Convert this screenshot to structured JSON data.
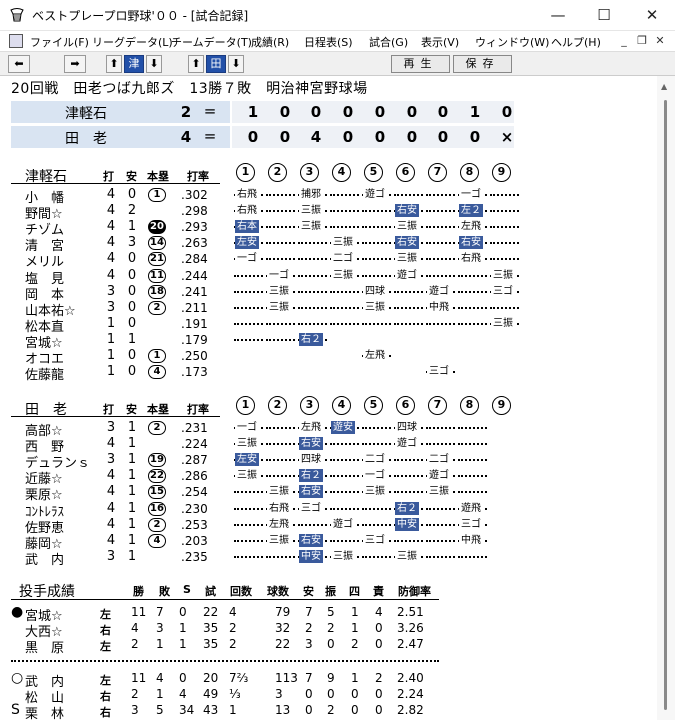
{
  "window": {
    "title": "ベストプレープロ野球'００ - [試合記録]",
    "minimize": "—",
    "maximize": "☐",
    "close": "✕"
  },
  "menu": [
    "ファイル(F)",
    "リーグデータ(L)",
    "チームデータ(T)",
    "成績(R)",
    "日程表(S)",
    "試合(G)",
    "表示(V)",
    "ウィンドウ(W)",
    "ヘルプ(H)"
  ],
  "toolbar": {
    "team_a": "津",
    "team_b": "田",
    "replay": "再生",
    "save": "保存"
  },
  "game": {
    "header": "20回戦　田老つば九郎ズ　13勝７敗　明治神宮野球場"
  },
  "scoreboard": [
    {
      "team": "津軽石",
      "total": "2",
      "eq": "=",
      "innings": [
        "1",
        "0",
        "0",
        "0",
        "0",
        "0",
        "0",
        "1",
        "0"
      ]
    },
    {
      "team": "田　老",
      "total": "4",
      "eq": "=",
      "innings": [
        "0",
        "0",
        "4",
        "0",
        "0",
        "0",
        "0",
        "0",
        "×"
      ]
    }
  ],
  "bat_headers": {
    "at_bats": "打",
    "hits": "安",
    "hr": "本塁",
    "avg": "打率",
    "innings": [
      "1",
      "2",
      "3",
      "4",
      "5",
      "6",
      "7",
      "8",
      "9"
    ]
  },
  "away_batting": {
    "team": "津軽石",
    "players": [
      {
        "name": "小　幡",
        "ab": "4",
        "h": "0",
        "hr": "1",
        "hr_fill": false,
        "avg": ".302",
        "results": [
          [
            "右飛",
            "n"
          ],
          [
            "",
            "dot"
          ],
          [
            "捕邪",
            "n"
          ],
          [
            "",
            "dot"
          ],
          [
            "遊ゴ",
            "n"
          ],
          [
            "",
            "dot"
          ],
          [
            "",
            "dot"
          ],
          [
            "一ゴ",
            "n"
          ],
          [
            "",
            "dot"
          ]
        ]
      },
      {
        "name": "野間☆",
        "ab": "4",
        "h": "2",
        "hr": "",
        "hr_fill": false,
        "avg": ".298",
        "results": [
          [
            "右飛",
            "n"
          ],
          [
            "",
            "dot"
          ],
          [
            "三振",
            "n"
          ],
          [
            "",
            "dot"
          ],
          [
            "",
            "dot"
          ],
          [
            "右安",
            "h"
          ],
          [
            "",
            "dot"
          ],
          [
            "左２",
            "h"
          ],
          [
            "",
            "dot"
          ]
        ]
      },
      {
        "name": "チゾム",
        "ab": "4",
        "h": "1",
        "hr": "20",
        "hr_fill": true,
        "avg": ".293",
        "results": [
          [
            "右本",
            "h"
          ],
          [
            "",
            "dot"
          ],
          [
            "三振",
            "n"
          ],
          [
            "",
            "dot"
          ],
          [
            "",
            "dot"
          ],
          [
            "三振",
            "n"
          ],
          [
            "",
            "dot"
          ],
          [
            "左飛",
            "n"
          ],
          [
            "",
            "dot"
          ]
        ]
      },
      {
        "name": "清　宮",
        "ab": "4",
        "h": "3",
        "hr": "14",
        "hr_fill": false,
        "avg": ".263",
        "results": [
          [
            "左安",
            "h"
          ],
          [
            "",
            "dot"
          ],
          [
            "",
            "dot"
          ],
          [
            "三振",
            "n"
          ],
          [
            "",
            "dot"
          ],
          [
            "右安",
            "h"
          ],
          [
            "",
            "dot"
          ],
          [
            "右安",
            "h"
          ],
          [
            "",
            "dot"
          ]
        ]
      },
      {
        "name": "メリル",
        "ab": "4",
        "h": "0",
        "hr": "21",
        "hr_fill": false,
        "avg": ".284",
        "results": [
          [
            "一ゴ",
            "n"
          ],
          [
            "",
            "dot"
          ],
          [
            "",
            "dot"
          ],
          [
            "二ゴ",
            "n"
          ],
          [
            "",
            "dot"
          ],
          [
            "三振",
            "n"
          ],
          [
            "",
            "dot"
          ],
          [
            "右飛",
            "n"
          ],
          [
            "",
            "dot"
          ]
        ]
      },
      {
        "name": "塩　見",
        "ab": "4",
        "h": "0",
        "hr": "11",
        "hr_fill": false,
        "avg": ".244",
        "results": [
          [
            "",
            "dot"
          ],
          [
            "一ゴ",
            "n"
          ],
          [
            "",
            "dot"
          ],
          [
            "三振",
            "n"
          ],
          [
            "",
            "dot"
          ],
          [
            "遊ゴ",
            "n"
          ],
          [
            "",
            "dot"
          ],
          [
            "",
            "dot"
          ],
          [
            "三振",
            "n"
          ]
        ]
      },
      {
        "name": "岡　本",
        "ab": "3",
        "h": "0",
        "hr": "18",
        "hr_fill": false,
        "avg": ".241",
        "results": [
          [
            "",
            "dot"
          ],
          [
            "三振",
            "n"
          ],
          [
            "",
            "dot"
          ],
          [
            "",
            "dot"
          ],
          [
            "四球",
            "n"
          ],
          [
            "",
            "dot"
          ],
          [
            "遊ゴ",
            "n"
          ],
          [
            "",
            "dot"
          ],
          [
            "三ゴ",
            "n"
          ]
        ]
      },
      {
        "name": "山本祐☆",
        "ab": "3",
        "h": "0",
        "hr": "2",
        "hr_fill": false,
        "avg": ".211",
        "results": [
          [
            "",
            "dot"
          ],
          [
            "三振",
            "n"
          ],
          [
            "",
            "dot"
          ],
          [
            "",
            "dot"
          ],
          [
            "三振",
            "n"
          ],
          [
            "",
            "dot"
          ],
          [
            "中飛",
            "n"
          ],
          [
            "",
            "dot"
          ],
          [
            "",
            "dot"
          ]
        ]
      },
      {
        "name": "松本直",
        "ab": "1",
        "h": "0",
        "hr": "",
        "hr_fill": false,
        "avg": ".191",
        "results": [
          [
            "",
            "dot"
          ],
          [
            "",
            "dot"
          ],
          [
            "",
            "dot"
          ],
          [
            "",
            "dot"
          ],
          [
            "",
            "dot"
          ],
          [
            "",
            "dot"
          ],
          [
            "",
            "dot"
          ],
          [
            "",
            "dot"
          ],
          [
            "三振",
            "n"
          ]
        ]
      },
      {
        "name": "宮城☆",
        "ab": "1",
        "h": "1",
        "hr": "",
        "hr_fill": false,
        "avg": ".179",
        "results": [
          [
            "",
            "dot"
          ],
          [
            "",
            "dot"
          ],
          [
            "右２",
            "h"
          ],
          [
            "",
            "none"
          ],
          [
            "",
            "none"
          ],
          [
            "",
            "none"
          ],
          [
            "",
            "none"
          ],
          [
            "",
            "none"
          ],
          [
            "",
            "none"
          ]
        ]
      },
      {
        "name": "オコエ",
        "ab": "1",
        "h": "0",
        "hr": "1",
        "hr_fill": false,
        "avg": ".250",
        "results": [
          [
            "",
            "none"
          ],
          [
            "",
            "none"
          ],
          [
            "",
            "none"
          ],
          [
            "",
            "none"
          ],
          [
            "左飛",
            "n"
          ],
          [
            "",
            "none"
          ],
          [
            "",
            "none"
          ],
          [
            "",
            "none"
          ],
          [
            "",
            "none"
          ]
        ]
      },
      {
        "name": "佐藤龍",
        "ab": "1",
        "h": "0",
        "hr": "4",
        "hr_fill": false,
        "avg": ".173",
        "results": [
          [
            "",
            "none"
          ],
          [
            "",
            "none"
          ],
          [
            "",
            "none"
          ],
          [
            "",
            "none"
          ],
          [
            "",
            "none"
          ],
          [
            "",
            "none"
          ],
          [
            "三ゴ",
            "n"
          ],
          [
            "",
            "none"
          ],
          [
            "",
            "none"
          ]
        ]
      }
    ]
  },
  "home_batting": {
    "team": "田　老",
    "players": [
      {
        "name": "高部☆",
        "ab": "3",
        "h": "1",
        "hr": "2",
        "hr_fill": false,
        "avg": ".231",
        "results": [
          [
            "一ゴ",
            "n"
          ],
          [
            "",
            "dot"
          ],
          [
            "左飛",
            "n"
          ],
          [
            "遊安",
            "h"
          ],
          [
            "",
            "dot"
          ],
          [
            "四球",
            "n"
          ],
          [
            "",
            "dot"
          ],
          [
            "",
            "dot"
          ],
          [
            "",
            "none"
          ]
        ]
      },
      {
        "name": "西　野",
        "ab": "4",
        "h": "1",
        "hr": "",
        "hr_fill": false,
        "avg": ".224",
        "results": [
          [
            "三振",
            "n"
          ],
          [
            "",
            "dot"
          ],
          [
            "右安",
            "h"
          ],
          [
            "",
            "dot"
          ],
          [
            "",
            "dot"
          ],
          [
            "遊ゴ",
            "n"
          ],
          [
            "",
            "dot"
          ],
          [
            "",
            "dot"
          ],
          [
            "",
            "none"
          ]
        ]
      },
      {
        "name": "デュランｓ",
        "ab": "3",
        "h": "1",
        "hr": "19",
        "hr_fill": false,
        "avg": ".287",
        "results": [
          [
            "左安",
            "h"
          ],
          [
            "",
            "dot"
          ],
          [
            "四球",
            "n"
          ],
          [
            "",
            "dot"
          ],
          [
            "二ゴ",
            "n"
          ],
          [
            "",
            "dot"
          ],
          [
            "二ゴ",
            "n"
          ],
          [
            "",
            "dot"
          ],
          [
            "",
            "none"
          ]
        ]
      },
      {
        "name": "近藤☆",
        "ab": "4",
        "h": "1",
        "hr": "22",
        "hr_fill": false,
        "avg": ".286",
        "results": [
          [
            "三振",
            "n"
          ],
          [
            "",
            "dot"
          ],
          [
            "右２",
            "h"
          ],
          [
            "",
            "dot"
          ],
          [
            "一ゴ",
            "n"
          ],
          [
            "",
            "dot"
          ],
          [
            "遊ゴ",
            "n"
          ],
          [
            "",
            "dot"
          ],
          [
            "",
            "none"
          ]
        ]
      },
      {
        "name": "栗原☆",
        "ab": "4",
        "h": "1",
        "hr": "15",
        "hr_fill": false,
        "avg": ".254",
        "results": [
          [
            "",
            "dot"
          ],
          [
            "三振",
            "n"
          ],
          [
            "右安",
            "h"
          ],
          [
            "",
            "dot"
          ],
          [
            "三振",
            "n"
          ],
          [
            "",
            "dot"
          ],
          [
            "三振",
            "n"
          ],
          [
            "",
            "dot"
          ],
          [
            "",
            "none"
          ]
        ]
      },
      {
        "name": "ｺﾝﾄﾚﾗｽ",
        "ab": "4",
        "h": "1",
        "hr": "16",
        "hr_fill": false,
        "avg": ".230",
        "results": [
          [
            "",
            "dot"
          ],
          [
            "右飛",
            "n"
          ],
          [
            "三ゴ",
            "n"
          ],
          [
            "",
            "dot"
          ],
          [
            "",
            "dot"
          ],
          [
            "右２",
            "h"
          ],
          [
            "",
            "dot"
          ],
          [
            "遊飛",
            "n"
          ],
          [
            "",
            "none"
          ]
        ]
      },
      {
        "name": "佐野恵",
        "ab": "4",
        "h": "1",
        "hr": "2",
        "hr_fill": false,
        "avg": ".253",
        "results": [
          [
            "",
            "dot"
          ],
          [
            "左飛",
            "n"
          ],
          [
            "",
            "dot"
          ],
          [
            "遊ゴ",
            "n"
          ],
          [
            "",
            "dot"
          ],
          [
            "中安",
            "h"
          ],
          [
            "",
            "dot"
          ],
          [
            "三ゴ",
            "n"
          ],
          [
            "",
            "none"
          ]
        ]
      },
      {
        "name": "藤岡☆",
        "ab": "4",
        "h": "1",
        "hr": "4",
        "hr_fill": false,
        "avg": ".203",
        "results": [
          [
            "",
            "dot"
          ],
          [
            "三振",
            "n"
          ],
          [
            "右安",
            "h"
          ],
          [
            "",
            "dot"
          ],
          [
            "三ゴ",
            "n"
          ],
          [
            "",
            "dot"
          ],
          [
            "",
            "dot"
          ],
          [
            "中飛",
            "n"
          ],
          [
            "",
            "none"
          ]
        ]
      },
      {
        "name": "武　内",
        "ab": "3",
        "h": "1",
        "hr": "",
        "hr_fill": false,
        "avg": ".235",
        "results": [
          [
            "",
            "dot"
          ],
          [
            "",
            "dot"
          ],
          [
            "中安",
            "h"
          ],
          [
            "三振",
            "n"
          ],
          [
            "",
            "dot"
          ],
          [
            "三振",
            "n"
          ],
          [
            "",
            "dot"
          ],
          [
            "",
            "dot"
          ],
          [
            "",
            "none"
          ]
        ]
      }
    ]
  },
  "pitching": {
    "title": "投手成績",
    "headers": [
      "勝",
      "敗",
      "S",
      "試",
      "回数",
      "球数",
      "安",
      "振",
      "四",
      "責",
      "防御率"
    ],
    "away": [
      {
        "mark": "●",
        "name": "宮城☆",
        "hand": "左",
        "w": "11",
        "l": "7",
        "s": "0",
        "g": "22",
        "ip": "4",
        "pitches": "79",
        "h": "7",
        "k": "5",
        "bb": "1",
        "er": "4",
        "era": "2.51"
      },
      {
        "mark": "",
        "name": "大西☆",
        "hand": "右",
        "w": "4",
        "l": "3",
        "s": "1",
        "g": "35",
        "ip": "2",
        "pitches": "32",
        "h": "2",
        "k": "2",
        "bb": "1",
        "er": "0",
        "era": "3.26"
      },
      {
        "mark": "",
        "name": "黒　原",
        "hand": "左",
        "w": "2",
        "l": "1",
        "s": "1",
        "g": "35",
        "ip": "2",
        "pitches": "22",
        "h": "3",
        "k": "0",
        "bb": "2",
        "er": "0",
        "era": "2.47"
      }
    ],
    "home": [
      {
        "mark": "○",
        "name": "武　内",
        "hand": "左",
        "w": "11",
        "l": "4",
        "s": "0",
        "g": "20",
        "ip": "7⅔",
        "pitches": "113",
        "h": "7",
        "k": "9",
        "bb": "1",
        "er": "2",
        "era": "2.40"
      },
      {
        "mark": "",
        "name": "松　山",
        "hand": "右",
        "w": "2",
        "l": "1",
        "s": "4",
        "g": "49",
        "ip": "⅓",
        "pitches": "3",
        "h": "0",
        "k": "0",
        "bb": "0",
        "er": "0",
        "era": "2.24"
      },
      {
        "mark": "S",
        "name": "栗　林",
        "hand": "右",
        "w": "3",
        "l": "5",
        "s": "34",
        "g": "43",
        "ip": "1",
        "pitches": "13",
        "h": "0",
        "k": "2",
        "bb": "0",
        "er": "0",
        "era": "2.82"
      }
    ]
  }
}
